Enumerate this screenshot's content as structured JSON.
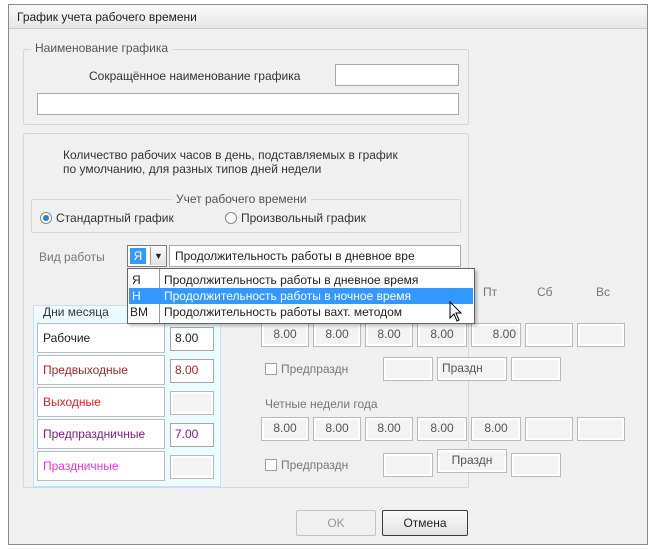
{
  "window": {
    "title": "График учета рабочего времени"
  },
  "name_group": {
    "legend": "Наименование графика",
    "short_name_label": "Сокращённое наименование графика",
    "short_name_value": "",
    "full_name_value": ""
  },
  "description": {
    "line1": "Количество рабочих часов в день, подставляемых в график",
    "line2": "по умолчанию, для разных типов дней недели"
  },
  "accounting_group": {
    "legend": "Учет рабочего времени",
    "option_standard": "Стандартный график",
    "option_custom": "Произвольный график",
    "selected": "standard"
  },
  "work_type": {
    "label": "Вид работы",
    "code": "Я",
    "value": "Продолжительность работы в дневное вре"
  },
  "dropdown": {
    "items": [
      {
        "code": "Я",
        "label": "Продолжительность работы в дневное время",
        "highlighted": false
      },
      {
        "code": "Н",
        "label": "Продолжительность работы в ночное время",
        "highlighted": true
      },
      {
        "code": "ВМ",
        "label": "Продолжительность работы вахт. методом",
        "highlighted": false
      }
    ]
  },
  "month_days": {
    "header": "Дни месяца",
    "rows": [
      {
        "label": "Рабочие",
        "value": "8.00",
        "color": "#222222"
      },
      {
        "label": "Предвыходные",
        "value": "8.00",
        "color": "#a0282c"
      },
      {
        "label": "Выходные",
        "value": "",
        "color": "#e2202a"
      },
      {
        "label": "Предпраздничные",
        "value": "7.00",
        "color": "#7a1a8a"
      },
      {
        "label": "Праздничные",
        "value": "",
        "color": "#e23bd6"
      }
    ]
  },
  "weekdays": {
    "fri": "Пт",
    "sat": "Сб",
    "sun": "Вс"
  },
  "odd_weeks": {
    "values": [
      "8.00",
      "8.00",
      "8.00",
      "8.00",
      "8.00",
      "",
      ""
    ],
    "pre_holiday_label": "Предпраздн",
    "holiday_label": "Праздн"
  },
  "even_weeks": {
    "title": "Четные недели года",
    "values": [
      "8.00",
      "8.00",
      "8.00",
      "8.00",
      "8.00",
      "",
      ""
    ],
    "pre_holiday_label": "Предпраздн",
    "holiday_label": "Праздн"
  },
  "buttons": {
    "ok": "OK",
    "cancel": "Отмена"
  },
  "colors": {
    "accent": "#3399ff",
    "highlight_bg": "#3399ff"
  }
}
